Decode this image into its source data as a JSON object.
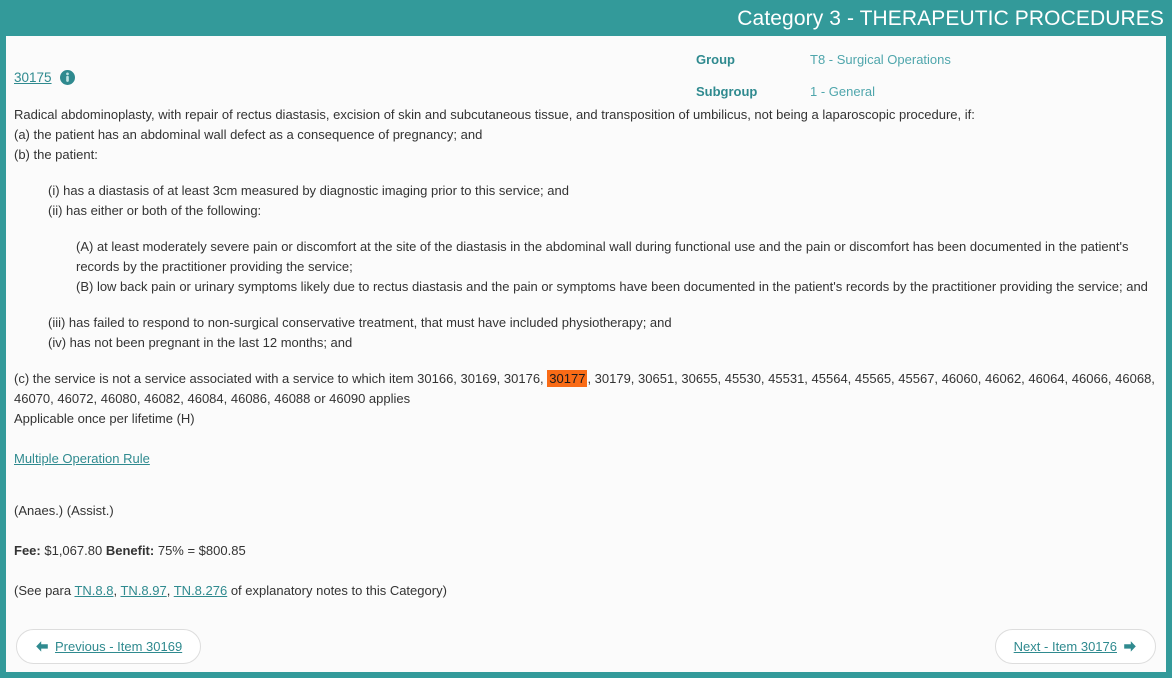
{
  "header": {
    "title": "Category 3 - THERAPEUTIC PROCEDURES",
    "background_color": "#339a9a",
    "text_color": "#ffffff"
  },
  "item": {
    "number": "30175",
    "info_icon": "info-circle-icon"
  },
  "meta": {
    "group_label": "Group",
    "group_value": "T8 - Surgical Operations",
    "subgroup_label": "Subgroup",
    "subgroup_value": "1 - General"
  },
  "description": {
    "lead": "Radical abdominoplasty, with repair of rectus diastasis, excision of skin and subcutaneous tissue, and transposition of umbilicus, not being a laparoscopic procedure, if:",
    "clause_a": "(a) the patient has an abdominal wall defect as a consequence of pregnancy; and",
    "clause_b": "(b) the patient:",
    "sub_i": "(i) has a diastasis of at least 3cm measured by diagnostic imaging prior to this service; and",
    "sub_ii": "(ii) has either or both of the following:",
    "sub_A": "(A) at least moderately severe pain or discomfort at the site of the diastasis in the abdominal wall during functional use and the pain or discomfort has been documented in the patient's records by the practitioner providing the service;",
    "sub_B": "(B) low back pain or urinary symptoms likely due to rectus diastasis and the pain or symptoms have been documented in the patient's records by the practitioner providing the service; and",
    "sub_iii": "(iii) has failed to respond to non-surgical conservative treatment, that must have included physiotherapy; and",
    "sub_iv": "(iv) has not been pregnant in the last 12 months; and",
    "clause_c_prefix": "(c) the service is not a service associated with a service to which item 30166, 30169, 30176, ",
    "clause_c_highlight": "30177",
    "clause_c_suffix": ", 30179, 30651, 30655, 45530, 45531, 45564, 45565, 45567, 46060, 46062, 46064, 46066, 46068, 46070, 46072, 46080, 46082, 46084, 46086, 46088 or 46090 applies",
    "applicable": "Applicable once per lifetime (H)",
    "highlight_color": "#f96b16"
  },
  "rules": {
    "multiple_operation_rule": "Multiple Operation Rule"
  },
  "flags": {
    "anaes_assist": "(Anaes.) (Assist.)"
  },
  "fee": {
    "fee_label": "Fee:",
    "fee_value": "$1,067.80",
    "benefit_label": "Benefit:",
    "benefit_value": "75% = $800.85"
  },
  "notes": {
    "prefix": "(See para ",
    "link1": "TN.8.8",
    "sep1": ", ",
    "link2": "TN.8.97",
    "sep2": ", ",
    "link3": "TN.8.276",
    "suffix": " of explanatory notes to this Category)"
  },
  "nav": {
    "previous_label": "Previous - Item 30169",
    "previous_icon": "arrow-left-icon",
    "next_label": "Next - Item 30176",
    "next_icon": "arrow-right-icon"
  }
}
